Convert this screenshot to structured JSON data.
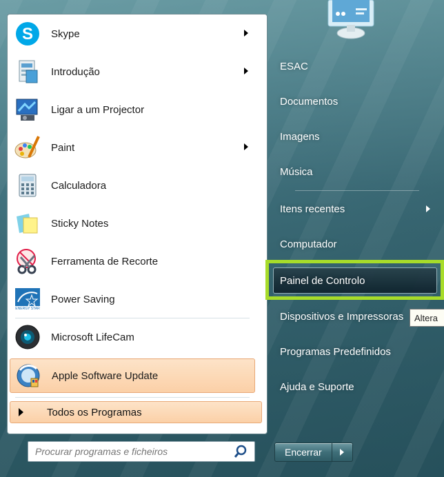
{
  "programs": [
    {
      "label": "Skype",
      "icon": "skype-icon",
      "has_submenu": true
    },
    {
      "label": "Introdução",
      "icon": "getting-started-icon",
      "has_submenu": true
    },
    {
      "label": "Ligar a um Projector",
      "icon": "projector-icon",
      "has_submenu": false
    },
    {
      "label": "Paint",
      "icon": "paint-icon",
      "has_submenu": true
    },
    {
      "label": "Calculadora",
      "icon": "calculator-icon",
      "has_submenu": false
    },
    {
      "label": "Sticky Notes",
      "icon": "sticky-notes-icon",
      "has_submenu": false
    },
    {
      "label": "Ferramenta de Recorte",
      "icon": "snipping-tool-icon",
      "has_submenu": false
    },
    {
      "label": "Power Saving",
      "icon": "energy-star-icon",
      "has_submenu": false
    },
    {
      "label": "Microsoft LifeCam",
      "icon": "webcam-icon",
      "has_submenu": false
    },
    {
      "label": "Apple Software Update",
      "icon": "apple-update-icon",
      "has_submenu": false
    }
  ],
  "all_programs": {
    "label": "Todos os Programas"
  },
  "search": {
    "placeholder": "Procurar programas e ficheiros"
  },
  "right": {
    "user": "ESAC",
    "documents": "Documentos",
    "pictures": "Imagens",
    "music": "Música",
    "recent": "Itens recentes",
    "computer": "Computador",
    "control_panel": "Painel de Controlo",
    "devices": "Dispositivos e Impressoras",
    "default_programs": "Programas Predefinidos",
    "help": "Ajuda e Suporte"
  },
  "tooltip": {
    "text": "Altera"
  },
  "shutdown": {
    "label": "Encerrar"
  },
  "colors": {
    "highlight_border": "#a7dc2a",
    "selected_fill": "#fbd0a7"
  }
}
